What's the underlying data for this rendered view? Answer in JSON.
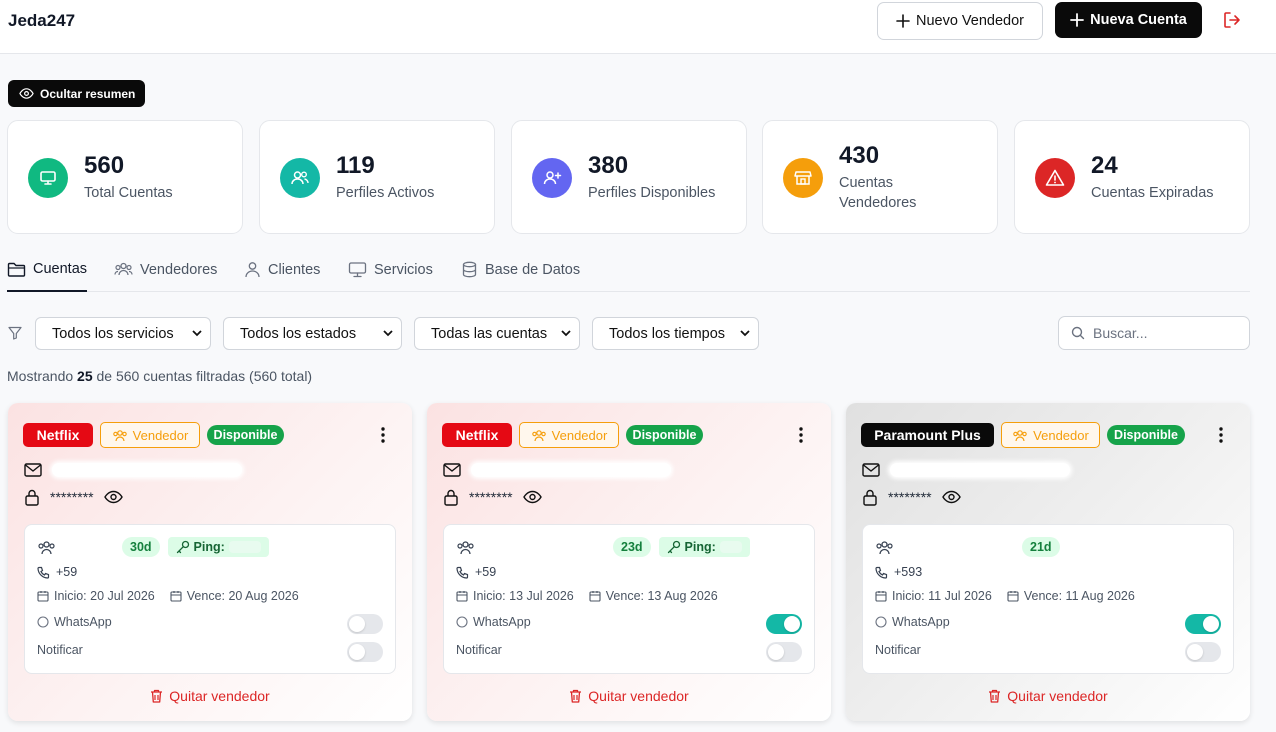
{
  "header": {
    "brand": "Jeda247",
    "new_seller_label": "Nuevo Vendedor",
    "new_account_label": "Nueva Cuenta"
  },
  "summary_toggle_label": "Ocultar resumen",
  "stats": [
    {
      "value": "560",
      "label": "Total Cuentas",
      "color": "#10b981",
      "icon": "monitor-icon"
    },
    {
      "value": "119",
      "label": "Perfiles Activos",
      "color": "#14b8a6",
      "icon": "users-icon"
    },
    {
      "value": "380",
      "label": "Perfiles Disponibles",
      "color": "#6366f1",
      "icon": "user-plus-icon"
    },
    {
      "value": "430",
      "label_line1": "Cuentas",
      "label_line2": "Vendedores",
      "color": "#f59e0b",
      "icon": "store-icon"
    },
    {
      "value": "24",
      "label": "Cuentas Expiradas",
      "color": "#dc2626",
      "icon": "alert-triangle-icon"
    }
  ],
  "tabs": [
    {
      "label": "Cuentas",
      "active": true
    },
    {
      "label": "Vendedores"
    },
    {
      "label": "Clientes"
    },
    {
      "label": "Servicios"
    },
    {
      "label": "Base de Datos"
    }
  ],
  "filters": {
    "service": "Todos los servicios",
    "status": "Todos los estados",
    "accounts": "Todas las cuentas",
    "time": "Todos los tiempos",
    "search_placeholder": "Buscar..."
  },
  "results": {
    "prefix": "Mostrando",
    "count": "25",
    "suffix": "de 560 cuentas filtradas (560 total)"
  },
  "cards": [
    {
      "service": "Netflix",
      "role": "Vendedor",
      "status": "Disponible",
      "password": "********",
      "profile_days": "30d",
      "ping_label": "Ping:",
      "phone_prefix": "+59",
      "start": "Inicio: 20 Jul 2026",
      "end": "Vence: 20 Aug 2026",
      "whatsapp_label": "WhatsApp",
      "whatsapp_on": false,
      "notify_label": "Notificar",
      "notify_on": false,
      "remove_label": "Quitar vendedor"
    },
    {
      "service": "Netflix",
      "role": "Vendedor",
      "status": "Disponible",
      "password": "********",
      "profile_days": "23d",
      "ping_label": "Ping:",
      "phone_prefix": "+59",
      "start": "Inicio: 13 Jul 2026",
      "end": "Vence: 13 Aug 2026",
      "whatsapp_label": "WhatsApp",
      "whatsapp_on": true,
      "notify_label": "Notificar",
      "notify_on": false,
      "remove_label": "Quitar vendedor"
    },
    {
      "service": "Paramount Plus",
      "role": "Vendedor",
      "status": "Disponible",
      "password": "********",
      "profile_days": "21d",
      "phone_prefix": "+593",
      "start": "Inicio: 11 Jul 2026",
      "end": "Vence: 11 Aug 2026",
      "whatsapp_label": "WhatsApp",
      "whatsapp_on": true,
      "notify_label": "Notificar",
      "notify_on": false,
      "remove_label": "Quitar vendedor"
    }
  ]
}
